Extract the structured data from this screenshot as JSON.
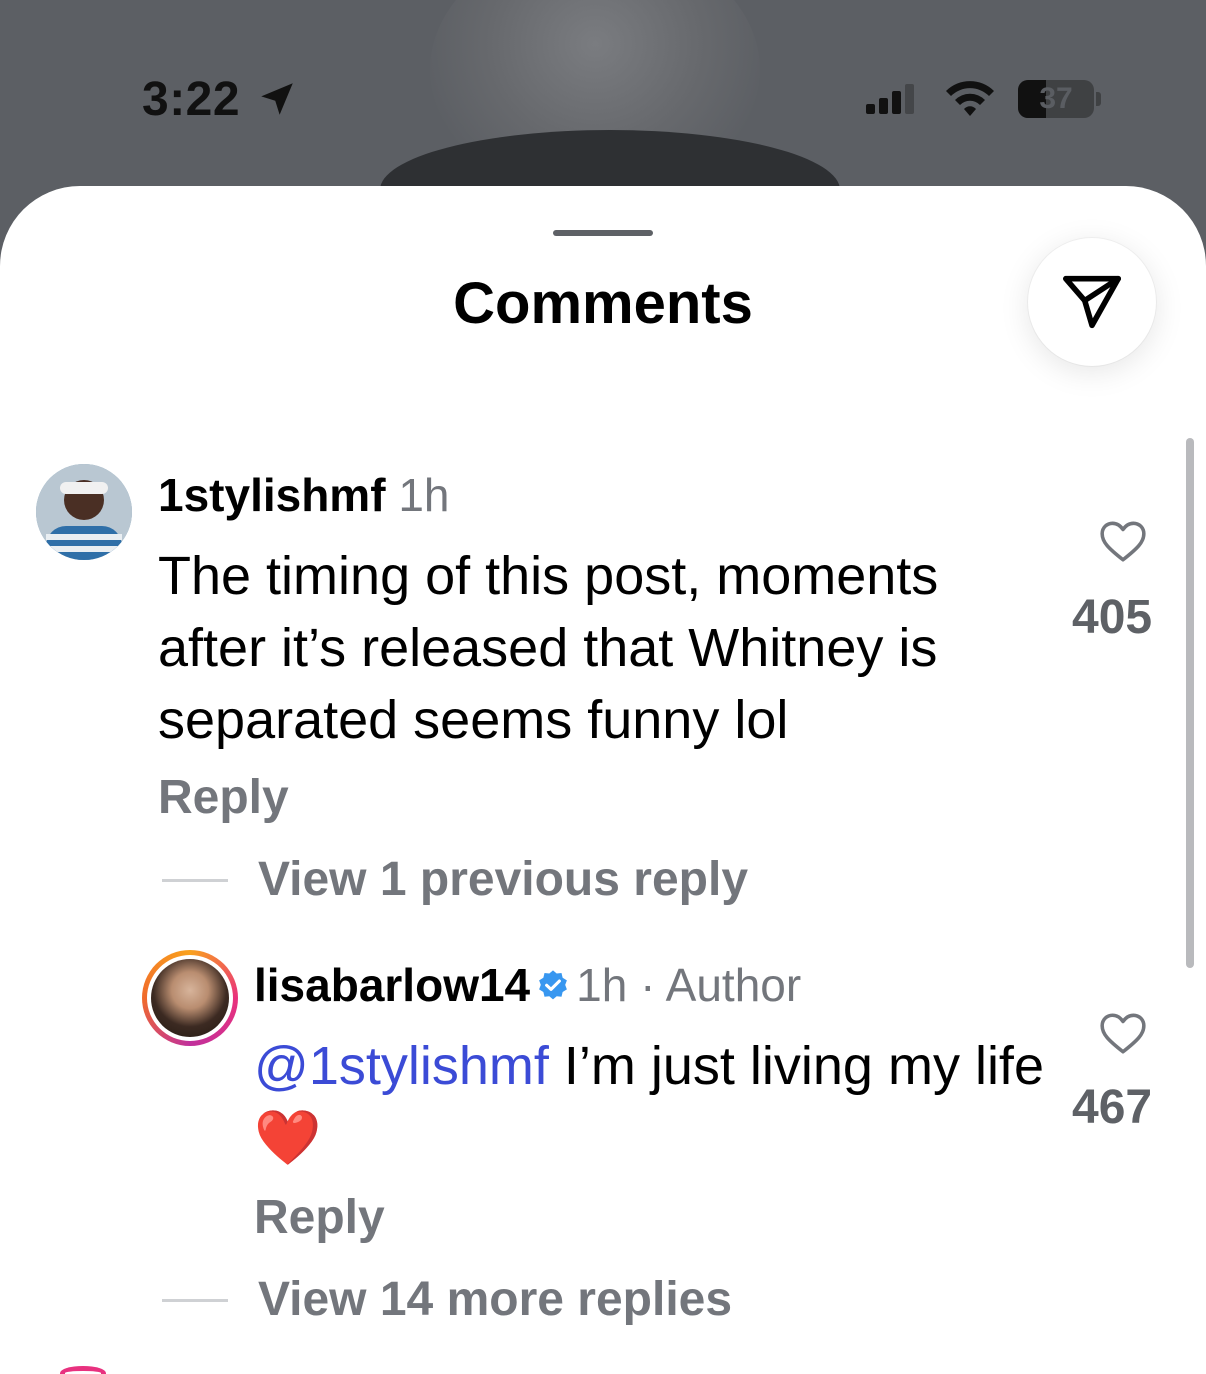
{
  "status_bar": {
    "time": "3:22",
    "battery_percent": "37",
    "battery_level": 0.37
  },
  "sheet": {
    "title": "Comments",
    "share_icon": "send-icon"
  },
  "comments": [
    {
      "username": "1stylishmf",
      "meta": "1h",
      "text": "The timing of this post, moments after it’s released that Whitney is separated seems funny lol",
      "reply_label": "Reply",
      "likes": "405"
    },
    {
      "username": "lisabarlow14",
      "meta": "1h · Author",
      "mention": "@1stylishmf",
      "text": " I’m just living my life",
      "emoji": "❤️",
      "reply_label": "Reply",
      "likes": "467"
    }
  ],
  "threads": {
    "view_previous": "View 1 previous reply",
    "view_more": "View 14 more replies"
  },
  "colors": {
    "mention": "#3b4bd6",
    "secondary_text": "#73767c",
    "verified": "#3897f0"
  }
}
